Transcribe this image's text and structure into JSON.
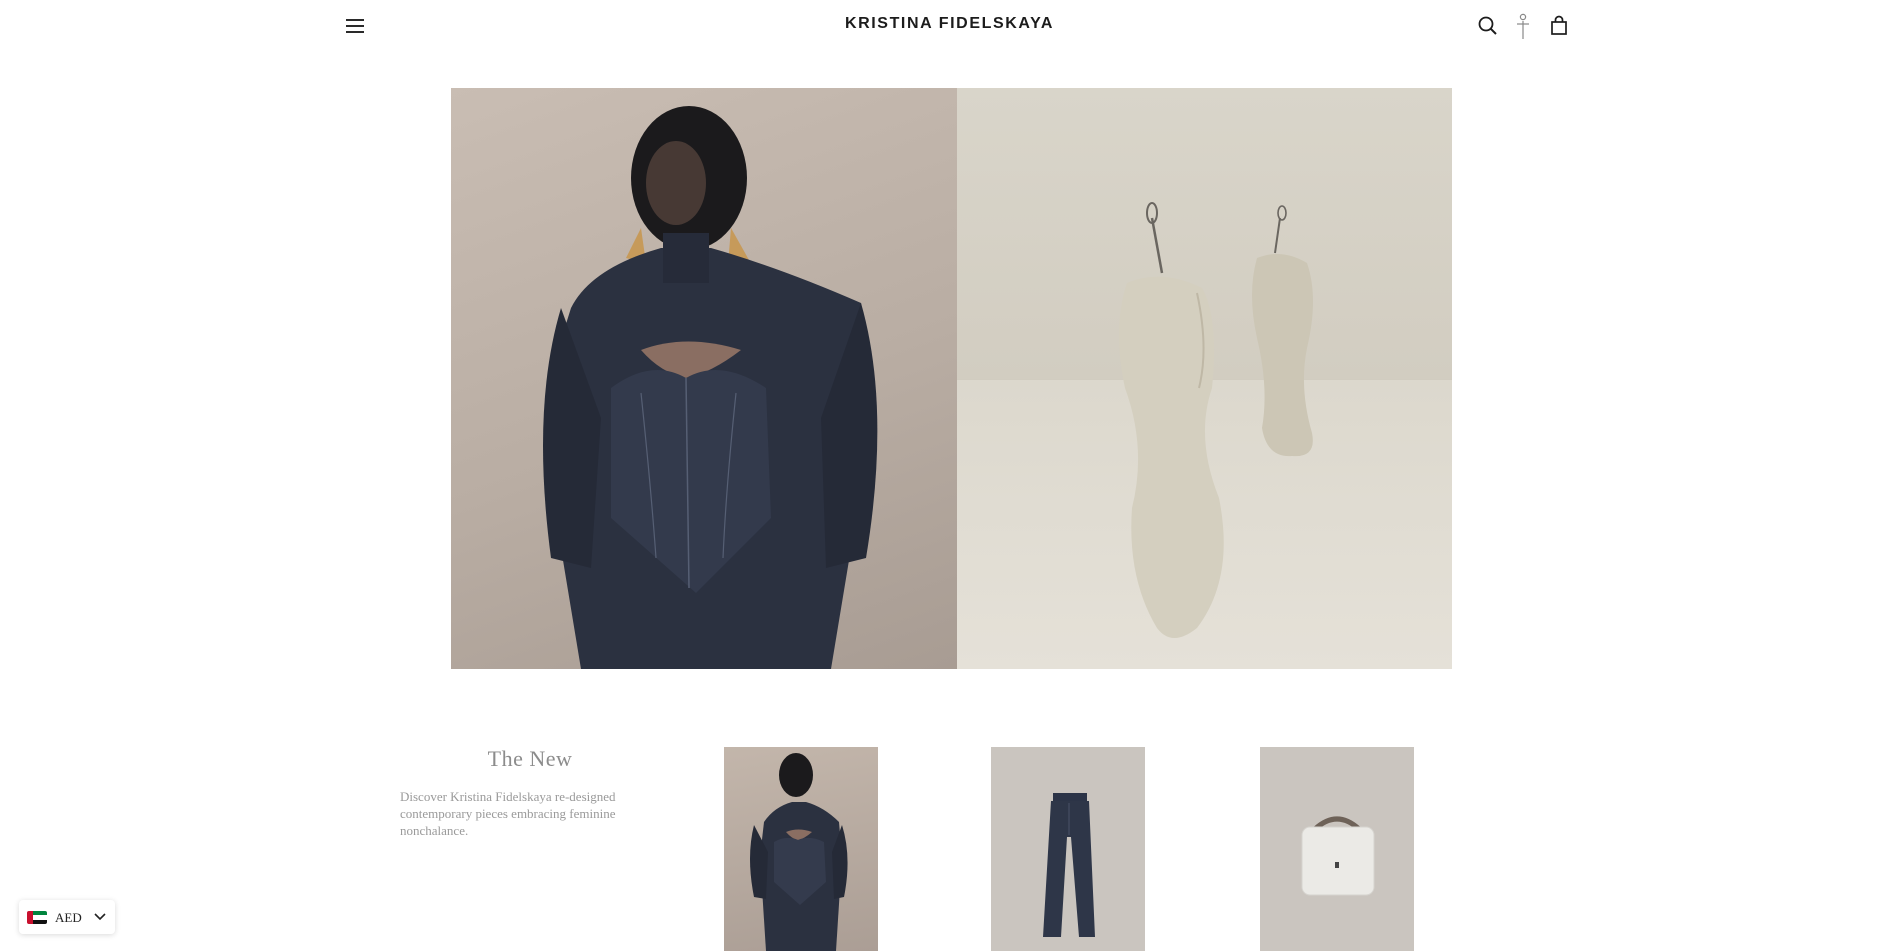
{
  "header": {
    "brand": "KRISTINA FIDELSKAYA",
    "menu_icon": "hamburger-menu-icon",
    "search_icon": "search-icon",
    "account_icon": "account-figure-icon",
    "cart_icon": "shopping-bag-icon"
  },
  "hero": {
    "left_image": "model in denim corset dress and veil",
    "right_image": "two beige mannequin torsos"
  },
  "intro": {
    "title": "The New",
    "description": "Discover Kristina Fidelskaya re-designed contemporary pieces embracing feminine nonchalance."
  },
  "products": [
    {
      "image": "denim corset dress"
    },
    {
      "image": "dark denim flared trousers"
    },
    {
      "image": "white leather handbag"
    }
  ],
  "currency": {
    "code": "AED",
    "flag_icon": "uae-flag-icon",
    "chevron_icon": "chevron-down-icon"
  },
  "colors": {
    "background": "#ffffff",
    "text": "#1c1c1c",
    "muted_text": "#8c8c8c"
  }
}
